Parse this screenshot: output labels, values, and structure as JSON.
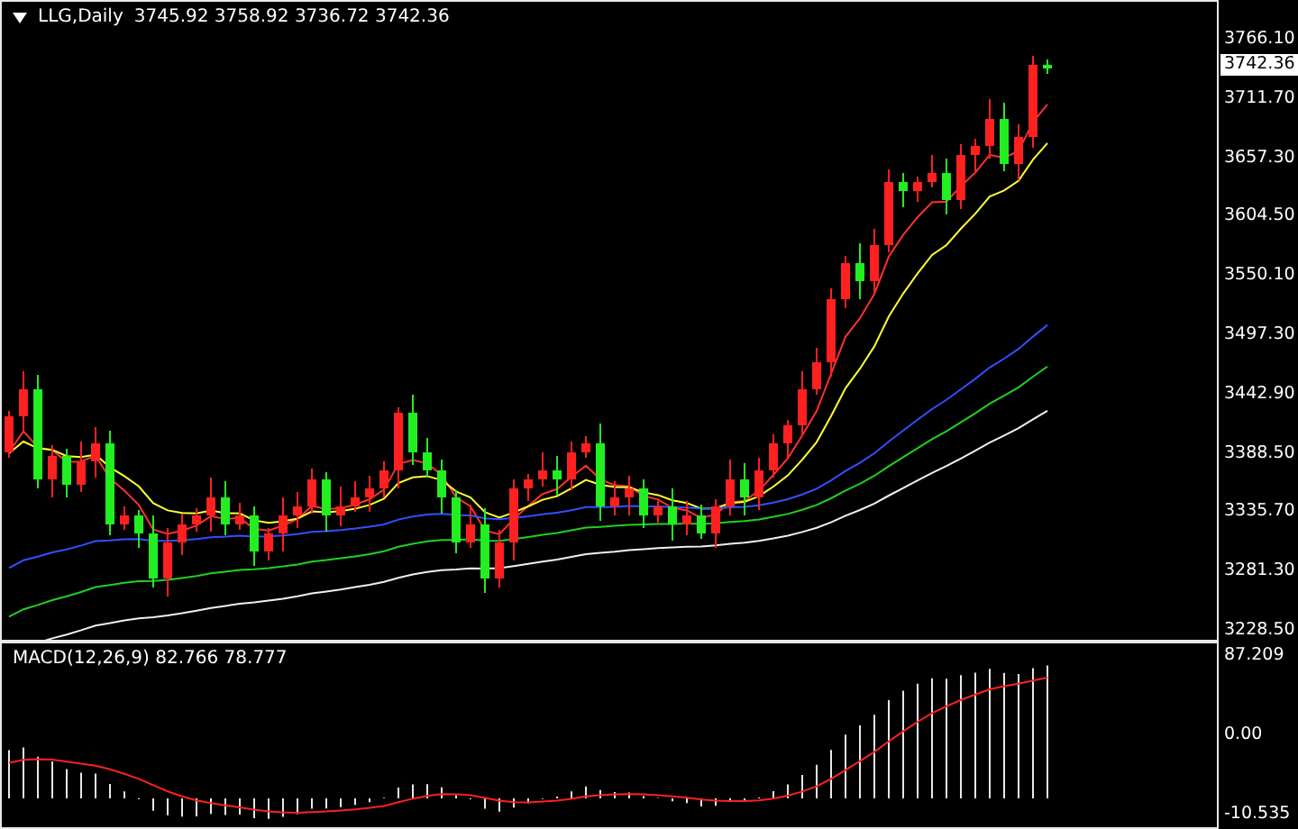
{
  "chart": {
    "symbol": "LLG,Daily",
    "ohlc": "3745.92 3758.92 3736.72 3742.36",
    "current_price": "3742.36",
    "price_axis": [
      "3766.10",
      "3711.70",
      "3657.30",
      "3604.50",
      "3550.10",
      "3497.30",
      "3442.90",
      "3388.50",
      "3335.70",
      "3281.30",
      "3228.50"
    ]
  },
  "macd": {
    "label": "MACD(12,26,9) 82.766 78.777",
    "axis": [
      "87.209",
      "0.00",
      "-10.535"
    ]
  }
}
